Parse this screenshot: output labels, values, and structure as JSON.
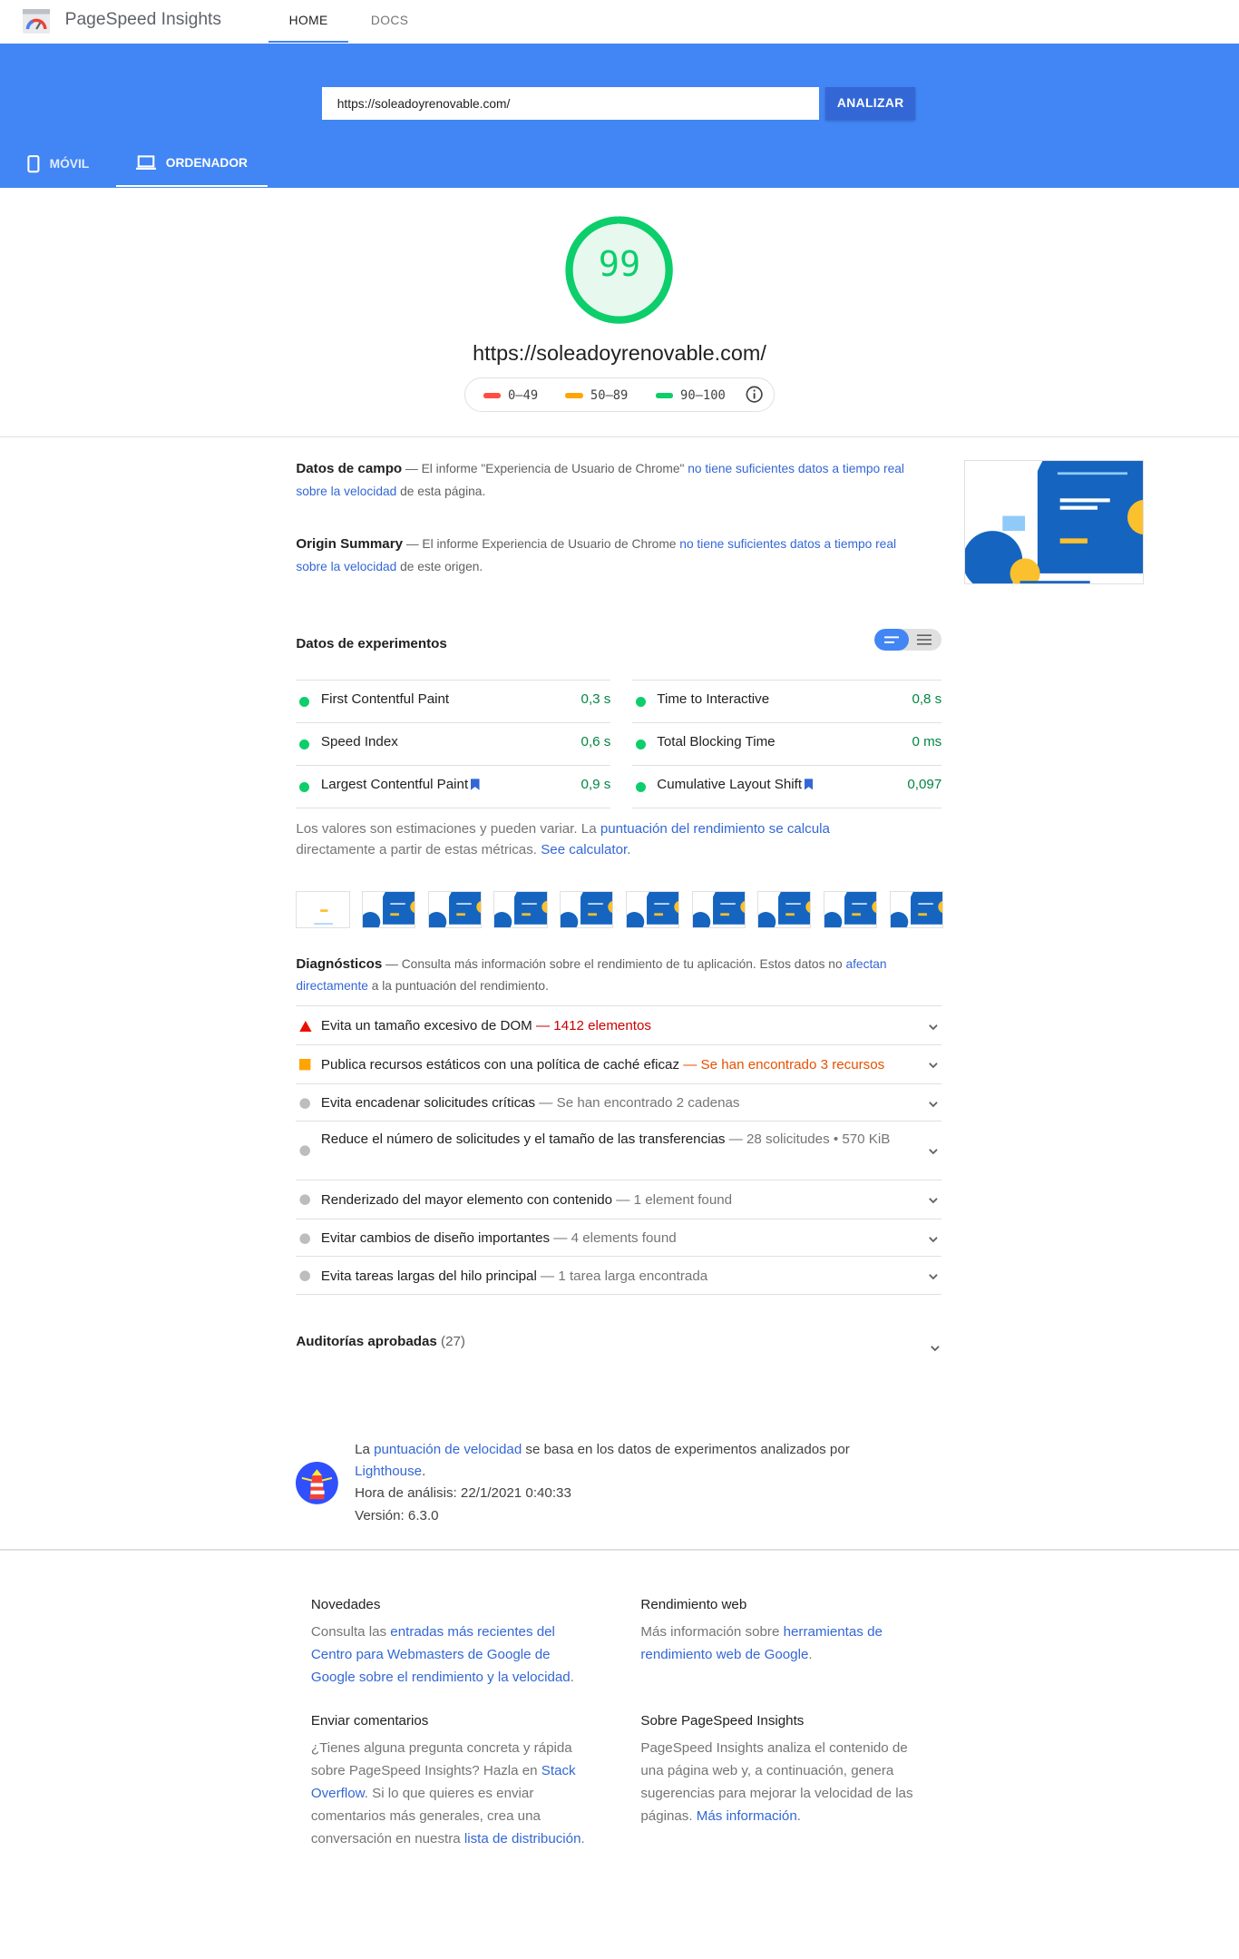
{
  "header": {
    "brand": "PageSpeed Insights",
    "tabs": [
      "HOME",
      "DOCS"
    ],
    "url_value": "https://soleadoyrenovable.com/",
    "analyze_label": "ANALIZAR",
    "device_tabs": [
      "MÓVIL",
      "ORDENADOR"
    ]
  },
  "score": {
    "value": "99",
    "level": 0.99,
    "url": "https://soleadoyrenovable.com/",
    "legend": [
      "0–49",
      "50–89",
      "90–100"
    ]
  },
  "colors": {
    "pass": "#0cce6b",
    "average": "#ffa400",
    "fail": "#ff4e42",
    "accent": "#4285f4"
  },
  "field": {
    "title": "Datos de campo",
    "text_a": " — El informe \"Experiencia de Usuario de Chrome\" ",
    "link_a": "no tiene suficientes datos a tiempo real sobre la velocidad",
    "text_b": " de esta página."
  },
  "origin": {
    "title": "Origin Summary",
    "text_a": " — El informe Experiencia de Usuario de Chrome ",
    "link_a": "no tiene suficientes datos a tiempo real sobre la velocidad",
    "text_b": " de este origen."
  },
  "lab": {
    "title": "Datos de experimentos",
    "metrics": [
      {
        "label": "First Contentful Paint",
        "value": "0,3 s"
      },
      {
        "label": "Time to Interactive",
        "value": "0,8 s"
      },
      {
        "label": "Speed Index",
        "value": "0,6 s"
      },
      {
        "label": "Total Blocking Time",
        "value": "0 ms"
      },
      {
        "label": "Largest Contentful Paint",
        "value": "0,9 s"
      },
      {
        "label": "Cumulative Layout Shift",
        "value": "0,097"
      }
    ],
    "note_a": "Los valores son estimaciones y pueden variar. La ",
    "note_link": "puntuación del rendimiento se calcula",
    "note_b": " directamente a partir de estas métricas. ",
    "note_link2": "See calculator."
  },
  "diagnostics": {
    "title": "Diagnósticos",
    "intro_a": " — Consulta más información sobre el rendimiento de tu aplicación. Estos datos no ",
    "intro_link": "afectan directamente",
    "intro_b": " a la puntuación del rendimiento.",
    "items": [
      {
        "title": "Evita un tamaño excesivo de DOM",
        "detail": " — 1412 elementos"
      },
      {
        "title": "Publica recursos estáticos con una política de caché eficaz",
        "detail": " — Se han encontrado 3 recursos"
      },
      {
        "title": "Evita encadenar solicitudes críticas",
        "detail": " — Se han encontrado 2 cadenas"
      },
      {
        "title": "Reduce el número de solicitudes y el tamaño de las transferencias",
        "detail": " — 28 solicitudes • 570 KiB"
      },
      {
        "title": "Renderizado del mayor elemento con contenido",
        "detail": " — 1 element found"
      },
      {
        "title": "Evitar cambios de diseño importantes",
        "detail": " — 4 elements found"
      },
      {
        "title": "Evita tareas largas del hilo principal",
        "detail": " — 1 tarea larga encontrada"
      }
    ]
  },
  "passed": {
    "title": "Auditorías aprobadas",
    "count": "(27)"
  },
  "lighthouse": {
    "text_a": "La ",
    "link_a": "puntuación de velocidad",
    "text_b": " se basa en los datos de experimentos analizados por ",
    "link_b": "Lighthouse",
    "time": "Hora de análisis: 22/1/2021 0:40:33",
    "version": "Versión: 6.3.0"
  },
  "footer": {
    "news": {
      "title": "Novedades",
      "text_a": "Consulta las ",
      "link": "entradas más recientes del Centro para Webmasters de Google de Google sobre el rendimiento y la velocidad",
      "text_b": "."
    },
    "perf": {
      "title": "Rendimiento web",
      "text_a": "Más información sobre ",
      "link": "herramientas de rendimiento web de Google",
      "text_b": "."
    },
    "feedback": {
      "title": "Enviar comentarios",
      "text_a": "¿Tienes alguna pregunta concreta y rápida sobre PageSpeed Insights? Hazla en ",
      "link": "Stack Overflow",
      "text_b": ". Si lo que quieres es enviar comentarios más generales, crea una conversación en nuestra ",
      "link2": "lista de distribución",
      "text_c": "."
    },
    "about": {
      "title": "Sobre PageSpeed Insights",
      "text_a": "PageSpeed Insights analiza el contenido de una página web y, a continuación, genera sugerencias para mejorar la velocidad de las páginas. ",
      "link": "Más información",
      "text_b": "."
    }
  }
}
